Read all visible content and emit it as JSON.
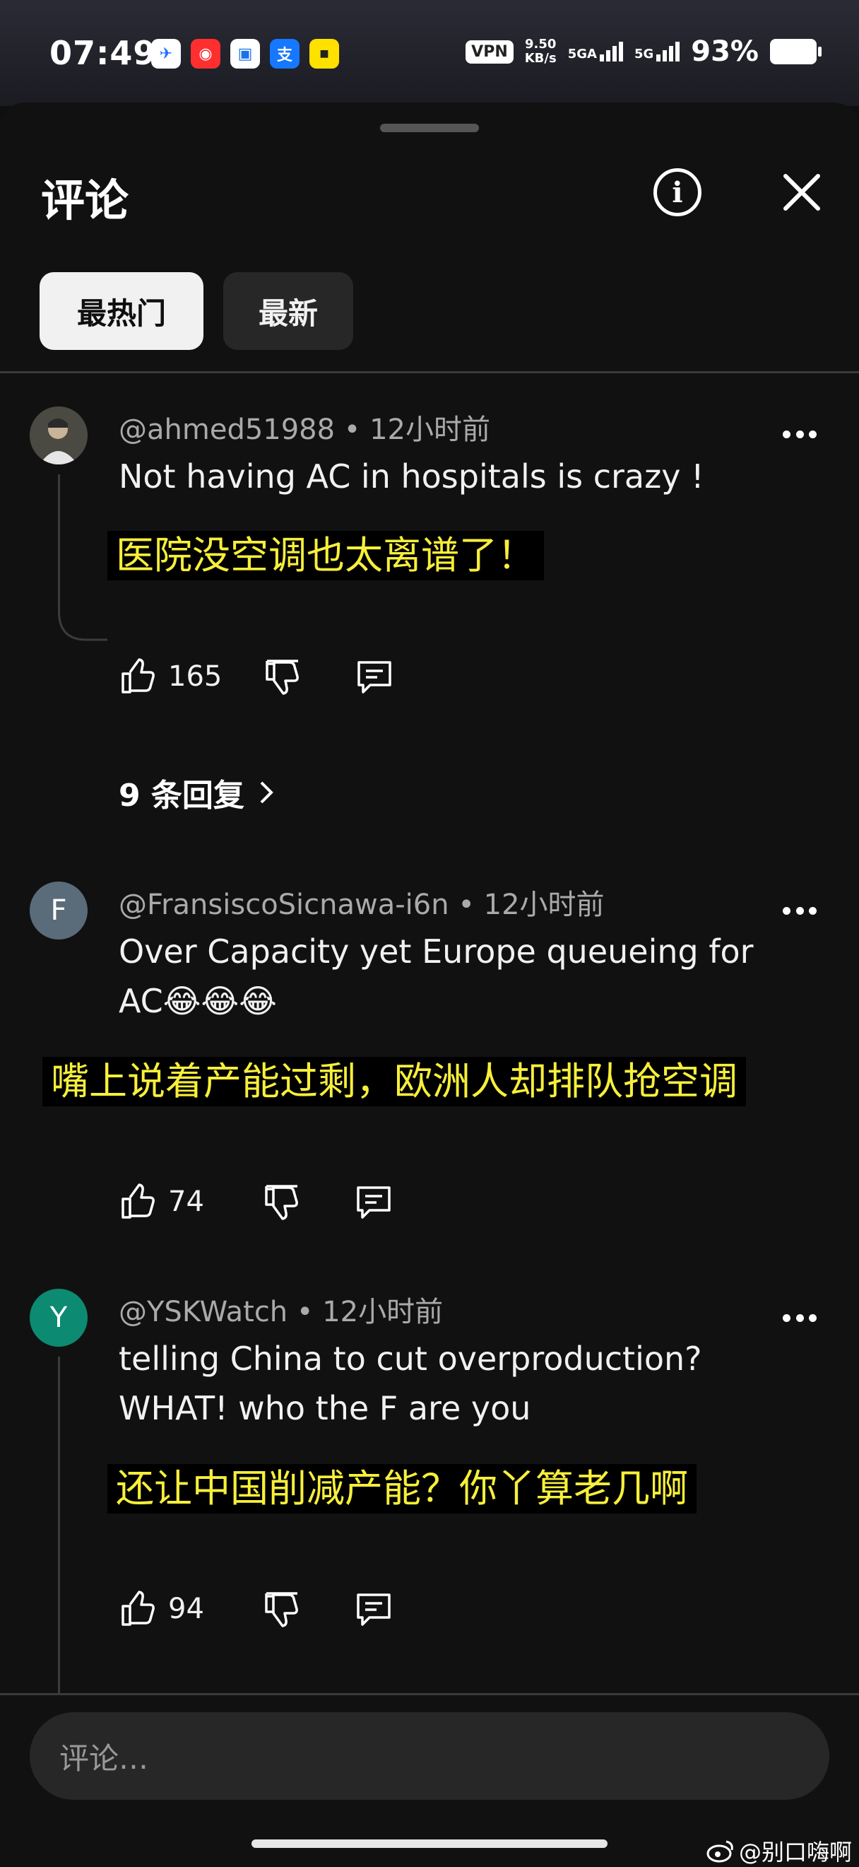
{
  "status_bar": {
    "time": "07:49",
    "vpn": "VPN",
    "speed_value": "9.50",
    "speed_unit": "KB/s",
    "sim1": "5GA",
    "sim2": "5G",
    "battery": "93%",
    "app_icons": [
      {
        "name": "feishu-icon",
        "glyph": "✈",
        "color": "#ffffff",
        "fg": "#1e6fff"
      },
      {
        "name": "red-mascot-icon",
        "glyph": "◉",
        "color": "#ff2f2f",
        "fg": "#ffffff"
      },
      {
        "name": "blue-app-icon",
        "glyph": "▣",
        "color": "#ffffff",
        "fg": "#1a73e8"
      },
      {
        "name": "alipay-icon",
        "glyph": "支",
        "color": "#1677ff",
        "fg": "#ffffff"
      },
      {
        "name": "yellow-app-icon",
        "glyph": "■",
        "color": "#ffe100",
        "fg": "#222222"
      }
    ]
  },
  "sheet": {
    "title": "评论",
    "tabs": [
      "最热门",
      "最新"
    ]
  },
  "comments": [
    {
      "author": "@ahmed51988",
      "time": "12小时前",
      "text": "Not having AC in hospitals is crazy !",
      "translation": "医院没空调也太离谱了！",
      "likes": "165",
      "replies": "9 条回复"
    },
    {
      "author": "@FransiscoSicnawa-i6n",
      "time": "12小时前",
      "avatar_letter": "F",
      "text": "Over Capacity yet Europe queueing for AC😂😂😂",
      "translation": "嘴上说着产能过剩，欧洲人却排队抢空调",
      "likes": "74"
    },
    {
      "author": "@YSKWatch",
      "time": "12小时前",
      "avatar_letter": "Y",
      "text": "telling China to cut overproduction? WHAT! who the F are you",
      "translation": "还让中国削减产能？你丫算老几啊",
      "likes": "94"
    }
  ],
  "input": {
    "placeholder": "评论…"
  },
  "watermark": "@别口嗨啊",
  "colors": {
    "background": "#0f0f0f",
    "subtitle_yellow": "#f7ef3a",
    "avatar_f": "#5a6b7a",
    "avatar_y": "#0c8a72"
  }
}
